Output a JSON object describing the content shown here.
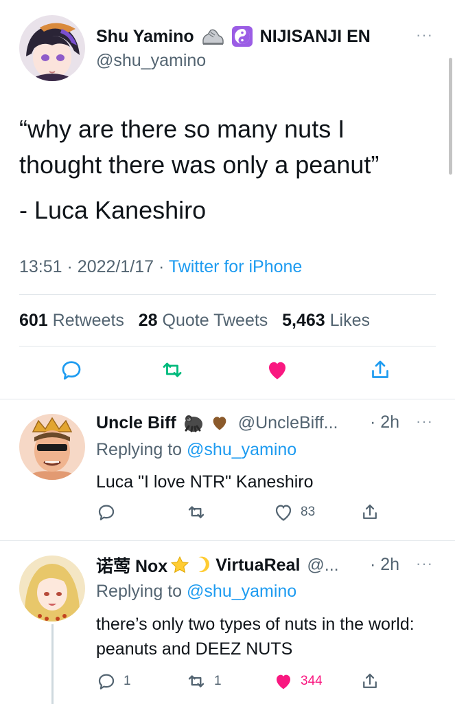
{
  "main_tweet": {
    "display_name": "Shu Yamino",
    "name_emojis": [
      "sneaker-emoji",
      "yin-yang-emoji"
    ],
    "affiliation": "NIJISANJI EN",
    "handle": "@shu_yamino",
    "text_lines": [
      "“why are there so many nuts I thought there was only a peanut”",
      "- Luca Kaneshiro"
    ],
    "time": "13:51",
    "date": "2022/1/17",
    "separator": "·",
    "source": "Twitter for iPhone",
    "retweets": {
      "count": "601",
      "label": "Retweets"
    },
    "quote_tweets": {
      "count": "28",
      "label": "Quote Tweets"
    },
    "likes": {
      "count": "5,463",
      "label": "Likes"
    },
    "liked": true,
    "more": "···"
  },
  "replies": [
    {
      "display_name": "Uncle Biff",
      "name_emojis": [
        "gorilla-emoji",
        "brown-heart-emoji"
      ],
      "handle": "@UncleBiff...",
      "time": "· 2h",
      "replying_prefix": "Replying to ",
      "replying_to": "@shu_yamino",
      "text": "Luca \"I love NTR\" Kaneshiro",
      "reply_count": "",
      "retweet_count": "",
      "like_count": "83",
      "liked": false,
      "more": "···"
    },
    {
      "display_name": "诺莺 Nox",
      "name_emojis": [
        "star-emoji",
        "crescent-moon-emoji"
      ],
      "affiliation": "VirtuaReal",
      "handle": "@...",
      "time": "· 2h",
      "replying_prefix": "Replying to ",
      "replying_to": "@shu_yamino",
      "text": "there’s only two types of nuts in the world: peanuts and DEEZ NUTS",
      "reply_count": "1",
      "retweet_count": "1",
      "like_count": "344",
      "liked": true,
      "more": "···"
    }
  ],
  "colors": {
    "accent_blue": "#1d9bf0",
    "like_pink": "#f91880",
    "retweet_green": "#00ba7c",
    "secondary_text": "#536471"
  }
}
